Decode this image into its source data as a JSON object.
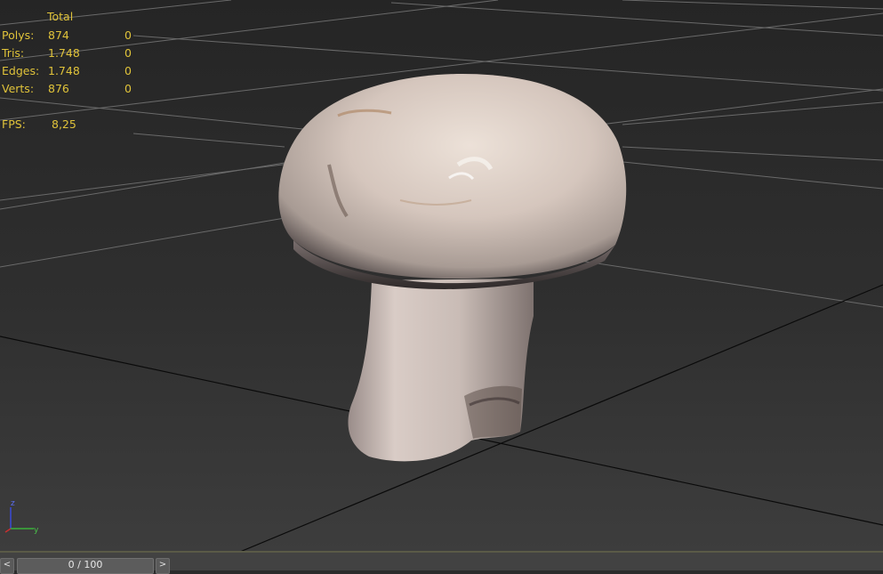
{
  "stats": {
    "header": "Total",
    "rows": [
      {
        "label": "Polys:",
        "total": "874",
        "selected": "0"
      },
      {
        "label": "Tris:",
        "total": "1.748",
        "selected": "0"
      },
      {
        "label": "Edges:",
        "total": "1.748",
        "selected": "0"
      },
      {
        "label": "Verts:",
        "total": "876",
        "selected": "0"
      }
    ],
    "fps_label": "FPS:",
    "fps_value": "8,25",
    "color": "#e0c33a"
  },
  "gizmo": {
    "z_label": "z",
    "y_label": "y"
  },
  "timeline": {
    "prev_label": "<",
    "frame_display": "0 / 100",
    "next_label": ">"
  },
  "icons": {
    "axis": "axis-gizmo-icon",
    "prev": "chevron-left-icon",
    "next": "chevron-right-icon"
  }
}
